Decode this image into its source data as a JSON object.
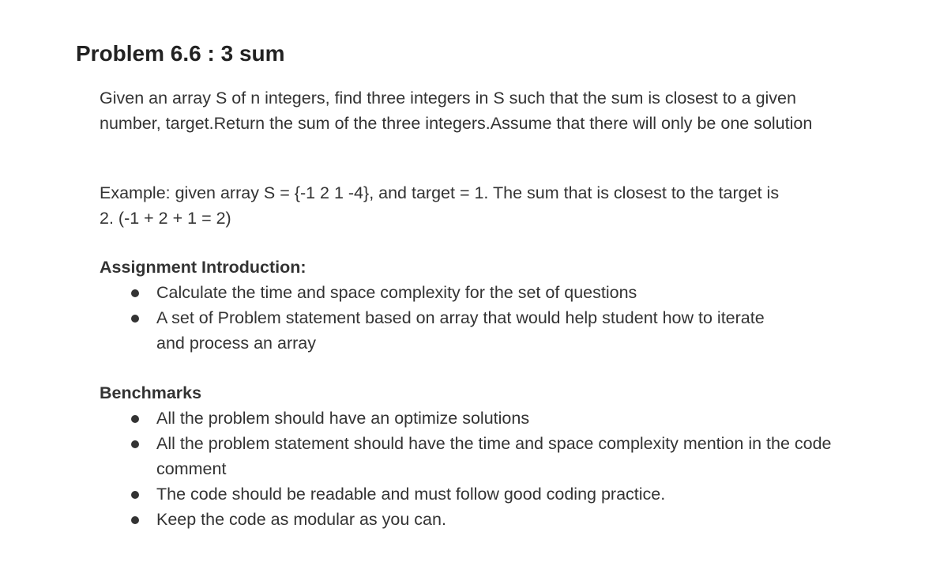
{
  "title": "Problem 6.6 : 3 sum",
  "description": "Given an array S of n integers, find three integers in S such that the sum is closest to a given number, target.Return the sum of the three integers.Assume that there will only be one solution",
  "example": "Example: given array S = {-1 2 1 -4}, and target = 1. The sum that is closest to the target is 2. (-1 + 2 + 1 = 2)",
  "assignment": {
    "heading": "Assignment Introduction:",
    "items": [
      "Calculate the time and space complexity for the set of questions",
      "A set of  Problem statement based on array that would help student how to iterate and process an array"
    ]
  },
  "benchmarks": {
    "heading": "Benchmarks",
    "items": [
      "All the problem should have an optimize solutions",
      "All the problem statement should have the time and space complexity mention in the code comment",
      "The code should be readable and must follow good coding practice.",
      "Keep the code as modular as you can."
    ]
  }
}
